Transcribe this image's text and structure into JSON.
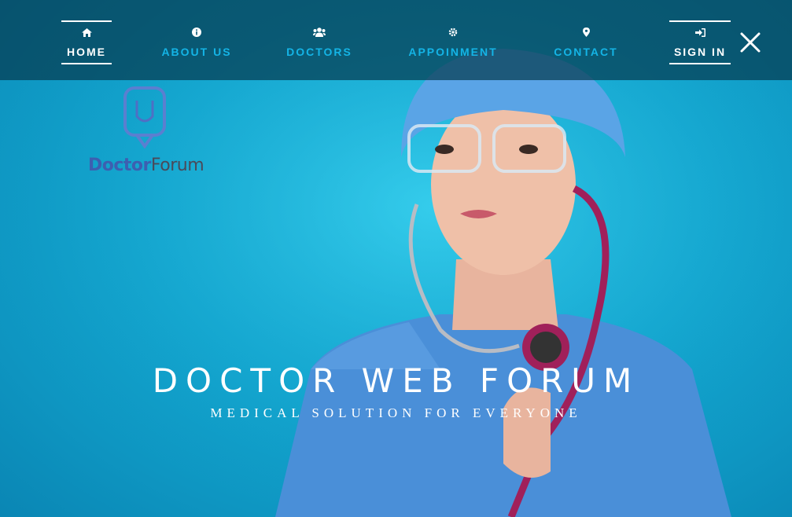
{
  "nav": {
    "items": [
      {
        "label": "HOME",
        "icon": "home-icon"
      },
      {
        "label": "ABOUT US",
        "icon": "info-icon"
      },
      {
        "label": "DOCTORS",
        "icon": "users-icon"
      },
      {
        "label": "APPOINMENT",
        "icon": "gear-icon"
      },
      {
        "label": "CONTACT",
        "icon": "map-marker-icon"
      },
      {
        "label": "SIGN IN",
        "icon": "sign-in-icon"
      }
    ],
    "close_icon": "close-icon"
  },
  "logo": {
    "text_a": "Doctor",
    "text_b": "Forum"
  },
  "hero": {
    "title": "DOCTOR WEB FORUM",
    "subtitle": "MEDICAL SOLUTION FOR EVERYONE"
  },
  "colors": {
    "accent": "#14b4e6",
    "nav_bg": "#063c50",
    "scrubs": "#4a8fd8",
    "cap": "#5aa4e6",
    "stethoscope": "#a0205a"
  }
}
